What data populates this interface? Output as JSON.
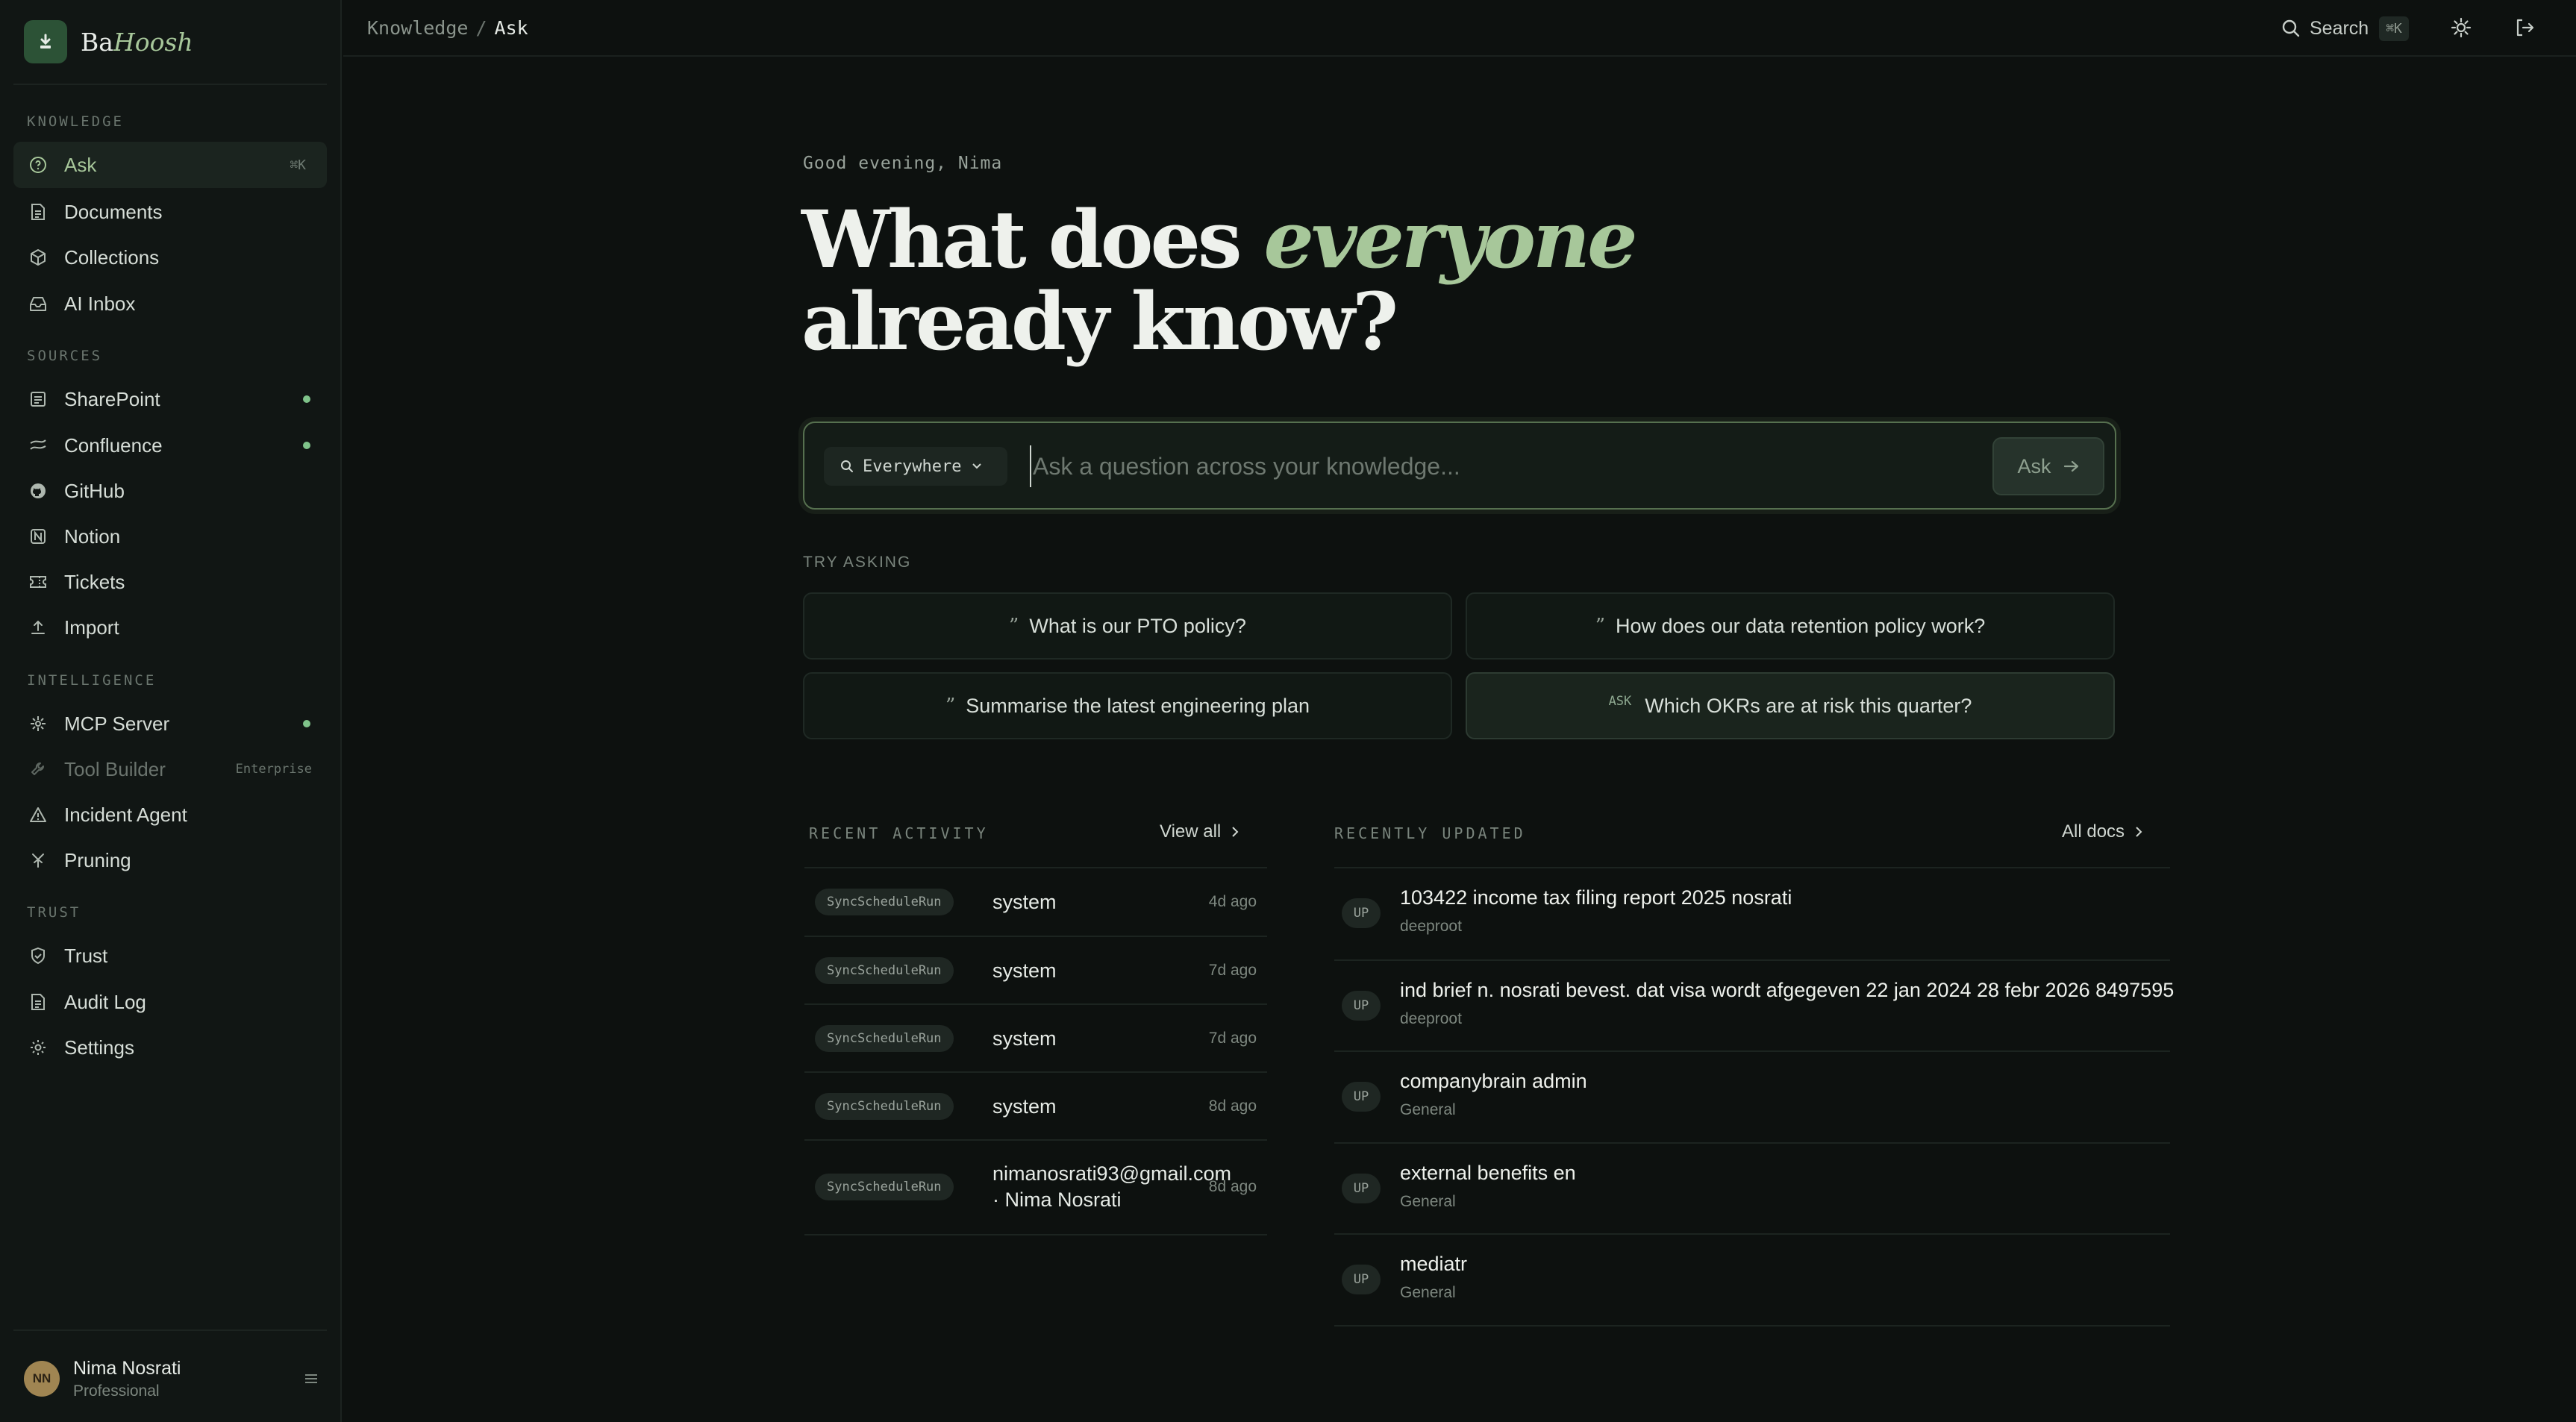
{
  "brand": {
    "name_plain": "Ba",
    "name_italic": "Hoosh"
  },
  "sidebar": {
    "sections": [
      {
        "label": "KNOWLEDGE"
      },
      {
        "label": "SOURCES"
      },
      {
        "label": "INTELLIGENCE"
      },
      {
        "label": "TRUST"
      }
    ],
    "items": [
      {
        "label": "Ask",
        "kbd": "⌘K"
      },
      {
        "label": "Documents"
      },
      {
        "label": "Collections"
      },
      {
        "label": "AI Inbox"
      },
      {
        "label": "SharePoint"
      },
      {
        "label": "Confluence"
      },
      {
        "label": "GitHub"
      },
      {
        "label": "Notion"
      },
      {
        "label": "Tickets"
      },
      {
        "label": "Import"
      },
      {
        "label": "MCP Server"
      },
      {
        "label": "Tool Builder",
        "tag": "Enterprise"
      },
      {
        "label": "Incident Agent"
      },
      {
        "label": "Pruning"
      },
      {
        "label": "Trust"
      },
      {
        "label": "Audit Log"
      },
      {
        "label": "Settings"
      }
    ],
    "user": {
      "initials": "NN",
      "name": "Nima Nosrati",
      "plan": "Professional"
    }
  },
  "topbar": {
    "crumb_root": "Knowledge",
    "crumb_sep": "/",
    "crumb_current": "Ask",
    "search_label": "Search",
    "search_kbd": "⌘K"
  },
  "hero": {
    "greeting": "Good evening, Nima",
    "line1_plain": "What does ",
    "line1_accent": "everyone",
    "line2": "already know?"
  },
  "ask": {
    "scope": "Everywhere",
    "placeholder": "Ask a question across your knowledge...",
    "button": "Ask"
  },
  "try": {
    "label": "TRY ASKING",
    "quote_mark": "”",
    "ask_tag": "ASK",
    "suggestions": [
      "What is our PTO policy?",
      "How does our data retention policy work?",
      "Summarise the latest engineering plan",
      "Which OKRs are at risk this quarter?"
    ]
  },
  "recent_activity": {
    "heading": "RECENT ACTIVITY",
    "link": "View all",
    "rows": [
      {
        "event": "SyncScheduleRun",
        "actor": "system",
        "time": "4d ago"
      },
      {
        "event": "SyncScheduleRun",
        "actor": "system",
        "time": "7d ago"
      },
      {
        "event": "SyncScheduleRun",
        "actor": "system",
        "time": "7d ago"
      },
      {
        "event": "SyncScheduleRun",
        "actor": "system",
        "time": "8d ago"
      },
      {
        "event": "SyncScheduleRun",
        "actor_line1": "nimanosrati93@gmail.com",
        "actor_line2": "· Nima Nosrati",
        "time": "8d ago"
      }
    ]
  },
  "recently_updated": {
    "heading": "RECENTLY UPDATED",
    "link": "All docs",
    "rows": [
      {
        "badge": "UP",
        "title": "103422 income tax filing report 2025 nosrati",
        "collection": "deeproot"
      },
      {
        "badge": "UP",
        "title": "ind brief n. nosrati bevest. dat visa wordt afgegeven 22 jan 2024 28 febr 2026 8497595",
        "collection": "deeproot"
      },
      {
        "badge": "UP",
        "title": "companybrain admin",
        "collection": "General"
      },
      {
        "badge": "UP",
        "title": "external benefits en",
        "collection": "General"
      },
      {
        "badge": "UP",
        "title": "mediatr",
        "collection": "General"
      }
    ]
  },
  "colors": {
    "accent": "#a7c79a",
    "background": "#0d110f",
    "sidebar": "#111614",
    "status_dot": "#7fc38a",
    "brand_logo": "#2c5236"
  }
}
